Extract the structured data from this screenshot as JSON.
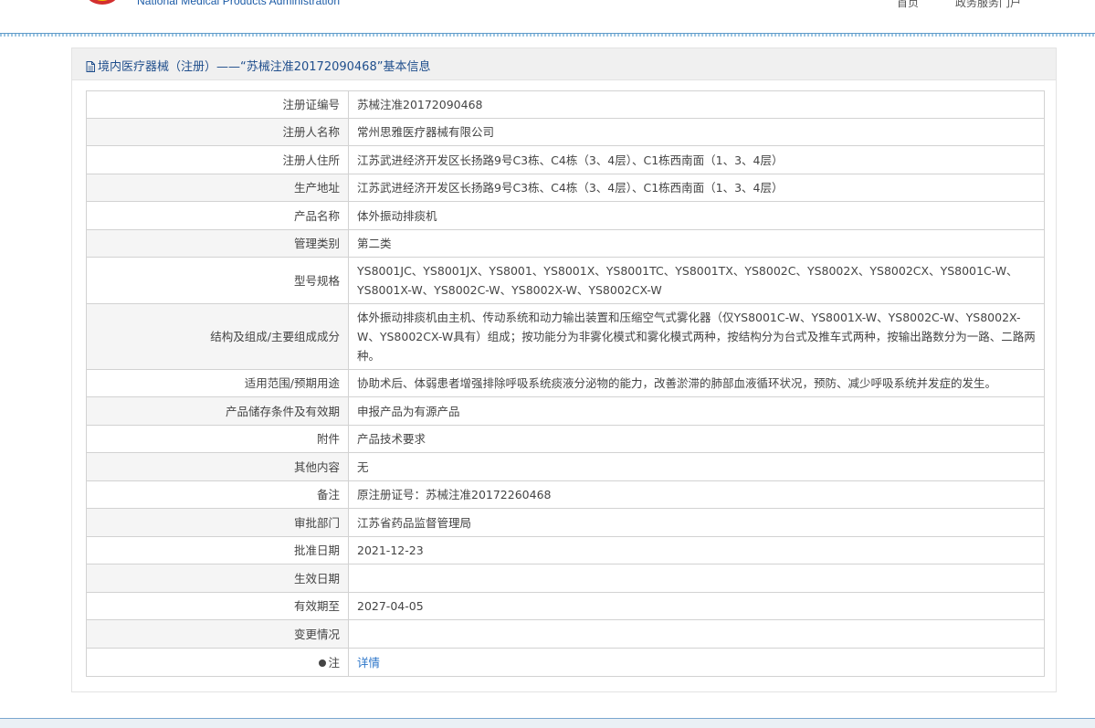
{
  "header": {
    "agency_en": "National Medical Products Administration",
    "nav_home": "首页",
    "nav_service": "政务服务门户"
  },
  "panel": {
    "title": "境内医疗器械（注册）——“苏械注准20172090468”基本信息"
  },
  "rows": [
    {
      "label": "注册证编号",
      "value": "苏械注准20172090468"
    },
    {
      "label": "注册人名称",
      "value": "常州思雅医疗器械有限公司"
    },
    {
      "label": "注册人住所",
      "value": "江苏武进经济开发区长扬路9号C3栋、C4栋（3、4层）、C1栋西南面（1、3、4层）"
    },
    {
      "label": "生产地址",
      "value": "江苏武进经济开发区长扬路9号C3栋、C4栋（3、4层）、C1栋西南面（1、3、4层）"
    },
    {
      "label": "产品名称",
      "value": "体外振动排痰机"
    },
    {
      "label": "管理类别",
      "value": "第二类"
    },
    {
      "label": "型号规格",
      "value": "YS8001JC、YS8001JX、YS8001、YS8001X、YS8001TC、YS8001TX、YS8002C、YS8002X、YS8002CX、YS8001C-W、YS8001X-W、YS8002C-W、YS8002X-W、YS8002CX-W"
    },
    {
      "label": "结构及组成/主要组成成分",
      "value": "体外振动排痰机由主机、传动系统和动力输出装置和压缩空气式雾化器（仅YS8001C-W、YS8001X-W、YS8002C-W、YS8002X-W、YS8002CX-W具有）组成；按功能分为非雾化模式和雾化模式两种，按结构分为台式及推车式两种，按输出路数分为一路、二路两种。"
    },
    {
      "label": "适用范围/预期用途",
      "value": "协助术后、体弱患者增强排除呼吸系统痰液分泌物的能力，改善淤滞的肺部血液循环状况，预防、减少呼吸系统并发症的发生。"
    },
    {
      "label": "产品储存条件及有效期",
      "value": "申报产品为有源产品"
    },
    {
      "label": "附件",
      "value": "产品技术要求"
    },
    {
      "label": "其他内容",
      "value": "无"
    },
    {
      "label": "备注",
      "value": "原注册证号：苏械注准20172260468"
    },
    {
      "label": "审批部门",
      "value": "江苏省药品监督管理局"
    },
    {
      "label": "批准日期",
      "value": "2021-12-23"
    },
    {
      "label": "生效日期",
      "value": ""
    },
    {
      "label": "有效期至",
      "value": "2027-04-05"
    },
    {
      "label": "变更情况",
      "value": ""
    }
  ],
  "note_row": {
    "label": "注",
    "link_text": "详情"
  }
}
